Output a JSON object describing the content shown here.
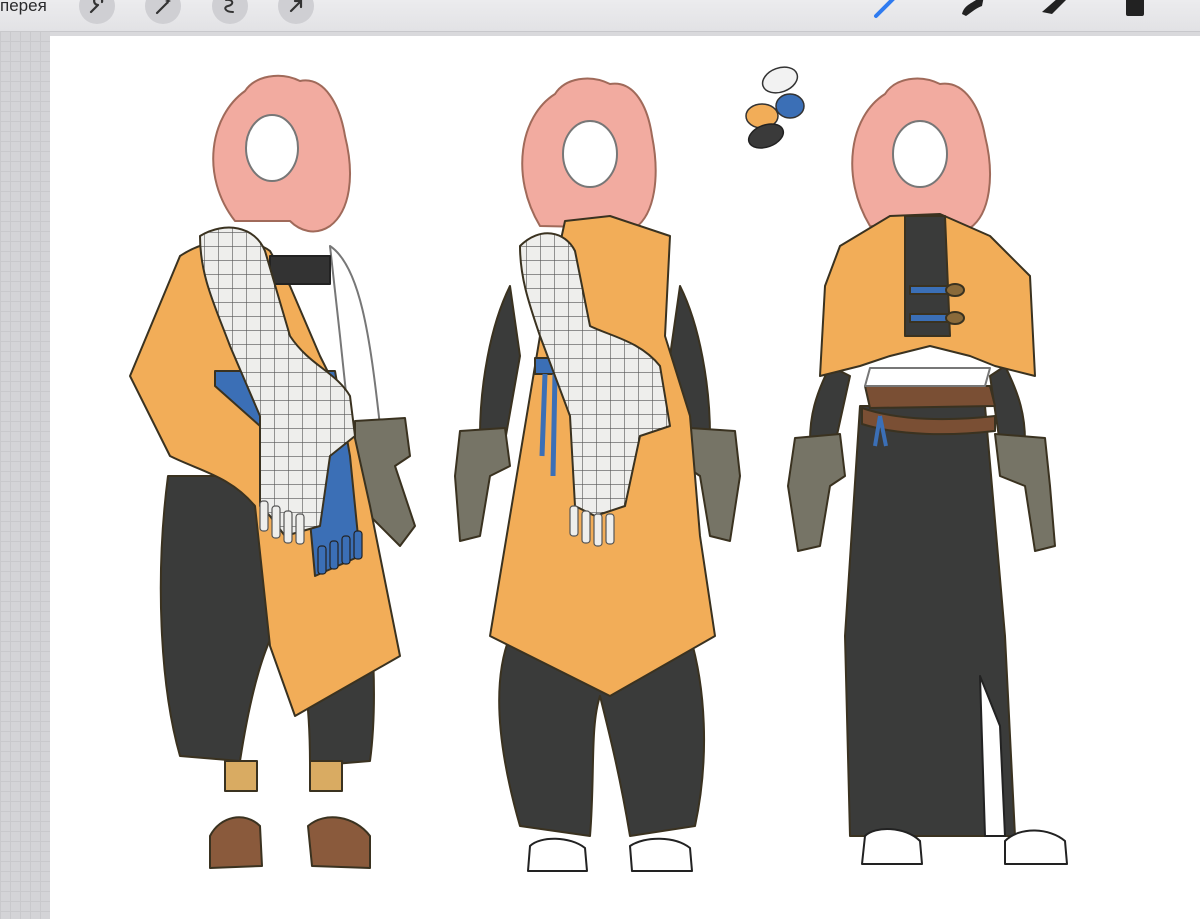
{
  "toolbar": {
    "gallery_label": "перея",
    "left_tools": [
      "wrench-icon",
      "magic-wand-icon",
      "selection-icon",
      "transform-arrow-icon"
    ],
    "right_tools": [
      "brush-icon",
      "smudge-icon",
      "eraser-icon",
      "layers-icon"
    ],
    "active_tool_color": "#2f7bf0"
  },
  "canvas": {
    "background": "#ffffff",
    "palette_swatches": [
      "#f2f2f2",
      "#f2ad58",
      "#3b6fb6",
      "#3a3a3a"
    ],
    "figures": [
      "outfit-design-1",
      "outfit-design-2",
      "outfit-design-3"
    ]
  }
}
